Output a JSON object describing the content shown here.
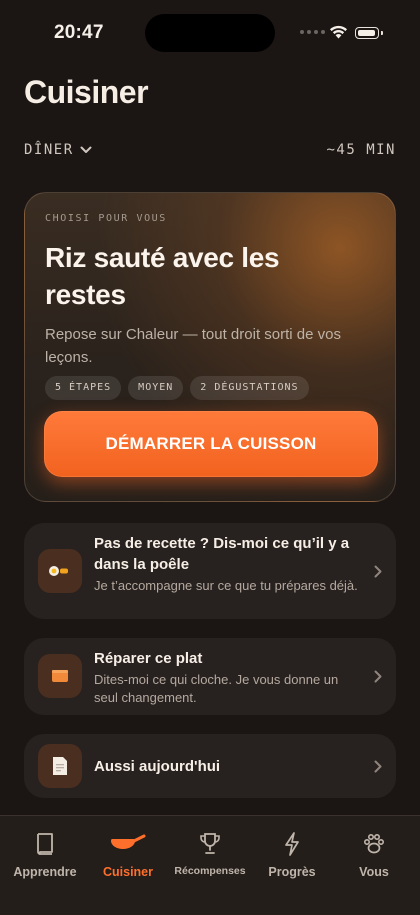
{
  "status_bar": {
    "time": "20:47"
  },
  "page": {
    "title": "Cuisiner"
  },
  "meal_selector": {
    "label": "DÎNER"
  },
  "duration": "~45 MIN",
  "hero": {
    "eyebrow": "CHOISI POUR VOUS",
    "title": "Riz sauté avec les restes",
    "description": "Repose sur Chaleur — tout droit sorti de vos leçons.",
    "tags": [
      "5 ÉTAPES",
      "MOYEN",
      "2 DÉGUSTATIONS"
    ],
    "cta_label": "DÉMARRER LA CUISSON"
  },
  "actions": [
    {
      "title": "Pas de recette ? Dis-moi ce qu’il y a dans la poêle",
      "subtitle": "Je t’accompagne sur ce que tu prépares déjà.",
      "icon": "pan-egg-icon"
    },
    {
      "title": "Réparer ce plat",
      "subtitle": "Dites-moi ce qui cloche. Je vous donne un seul changement.",
      "icon": "fix-box-icon"
    },
    {
      "title": "Aussi aujourd'hui",
      "subtitle": "",
      "icon": "note-icon"
    }
  ],
  "tabs": [
    {
      "label": "Apprendre",
      "icon": "book-icon",
      "active": false
    },
    {
      "label": "Cuisiner",
      "icon": "pan-icon",
      "active": true
    },
    {
      "label": "Récompenses",
      "icon": "trophy-icon",
      "active": false
    },
    {
      "label": "Progrès",
      "icon": "bolt-icon",
      "active": false
    },
    {
      "label": "Vous",
      "icon": "paw-icon",
      "active": false
    }
  ],
  "colors": {
    "accent": "#ff6f2c",
    "background": "#1b1614",
    "card": "#272120"
  }
}
